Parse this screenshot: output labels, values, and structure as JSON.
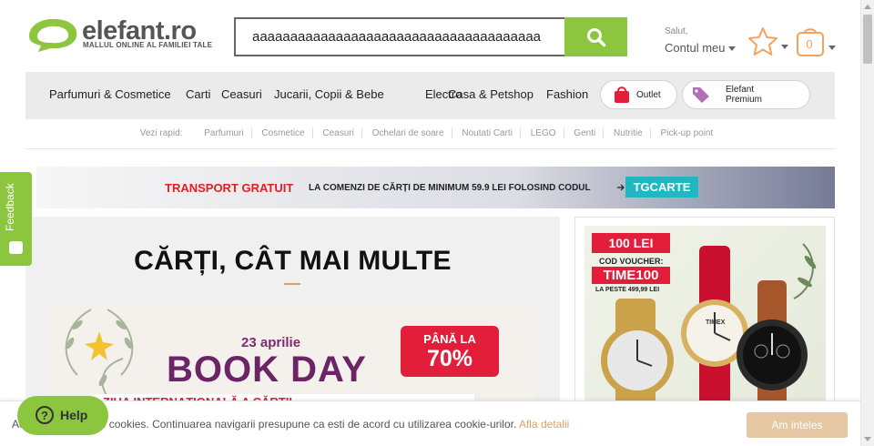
{
  "header": {
    "brand": "elefant.ro",
    "tagline": "MALLUL ONLINE AL FAMILIEI TALE",
    "search": {
      "value": "aaaaaaaaaaaaaaaaaaaaaaaaaaaaaaaaaaaaaa",
      "icon": "search-icon"
    },
    "account": {
      "greeting": "Salut,",
      "label": "Contul meu"
    },
    "favorites_icon": "star-icon",
    "cart": {
      "icon": "cart-icon",
      "count": "0"
    }
  },
  "nav": {
    "items": [
      "Parfumuri & Cosmetice",
      "Carti",
      "Ceasuri",
      "Jucarii, Copii & Bebe",
      "Electro",
      "Casa & Petshop",
      "Fashion"
    ],
    "outlet": "Outlet",
    "premium_line1": "Elefant",
    "premium_line2": "Premium"
  },
  "quick": {
    "label": "Vezi rapid:",
    "links": [
      "Parfumuri",
      "Cosmetice",
      "Ceasuri",
      "Ochelari de soare",
      "Noutati Carti",
      "LEGO",
      "Genti",
      "Nutritie",
      "Pick-up point"
    ]
  },
  "promo": {
    "headline": "TRANSPORT GRATUIT",
    "text": "LA COMENZI DE CĂRȚI DE MINIMUM 59.9 LEI FOLOSIND CODUL",
    "code": "TGCARTE"
  },
  "main": {
    "title": "CĂRȚI, CÂT MAI MULTE",
    "banner": {
      "date": "23 aprilie",
      "headline": "BOOK DAY",
      "tag_line1": "PÂNĂ LA",
      "tag_line2": "70%",
      "strip": "ZIUA INTERNAȚIONALĂ A CĂRȚII"
    }
  },
  "side": {
    "voucher_amount": "100 LEI",
    "voucher_label": "COD VOUCHER:",
    "voucher_code": "TIME100",
    "voucher_min": "LA PESTE 499,99 LEI",
    "brand_on_dial": "TIMEX"
  },
  "feedback": {
    "label": "Feedback"
  },
  "cookie": {
    "message": "Acest site folosește cookies. Continuarea navigarii presupune ca esti de acord cu utilizarea cookie-urilor.",
    "link": "Afla detalii",
    "accept": "Am inteles"
  },
  "help": {
    "label": "Help"
  },
  "colors": {
    "brand_green": "#8cc63f",
    "accent_orange": "#f5a25d",
    "promo_red": "#e0201f",
    "code_teal": "#1fb8c2"
  }
}
